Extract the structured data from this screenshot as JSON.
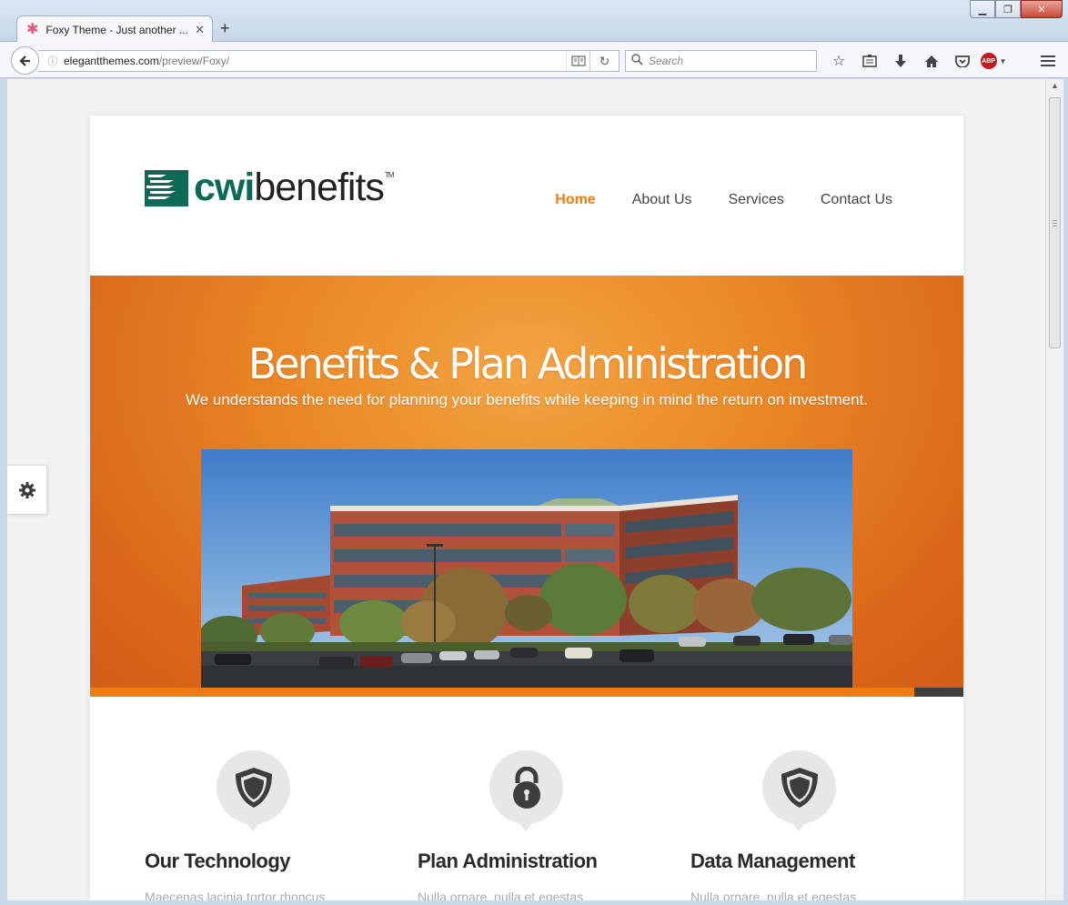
{
  "browser": {
    "tab_title": "Foxy Theme - Just another ...",
    "new_tab_symbol": "+",
    "url_domain": "elegantthemes.com",
    "url_path": "/preview/Foxy/",
    "search_placeholder": "Search",
    "abp_label": "ABP"
  },
  "site": {
    "logo_part1": "cwi",
    "logo_part2": "benefits",
    "logo_tm": "TM",
    "nav": [
      {
        "label": "Home",
        "active": true
      },
      {
        "label": "About Us",
        "active": false
      },
      {
        "label": "Services",
        "active": false
      },
      {
        "label": "Contact Us",
        "active": false
      }
    ]
  },
  "hero": {
    "title": "Benefits & Plan Administration",
    "subtitle": "We understands the need for planning your benefits while keeping in mind the return on investment."
  },
  "features": [
    {
      "title": "Our Technology",
      "desc": "Maecenas lacinia tortor rhoncus",
      "icon": "shield-icon"
    },
    {
      "title": "Plan Administration",
      "desc": "Nulla ornare, nulla et egestas",
      "icon": "lock-icon"
    },
    {
      "title": "Data Management",
      "desc": "Nulla ornare, nulla et egestas",
      "icon": "shield-icon"
    }
  ],
  "colors": {
    "accent": "#f07c10",
    "logo_green": "#0d6a57",
    "hero_orange": "#eb8a28"
  }
}
